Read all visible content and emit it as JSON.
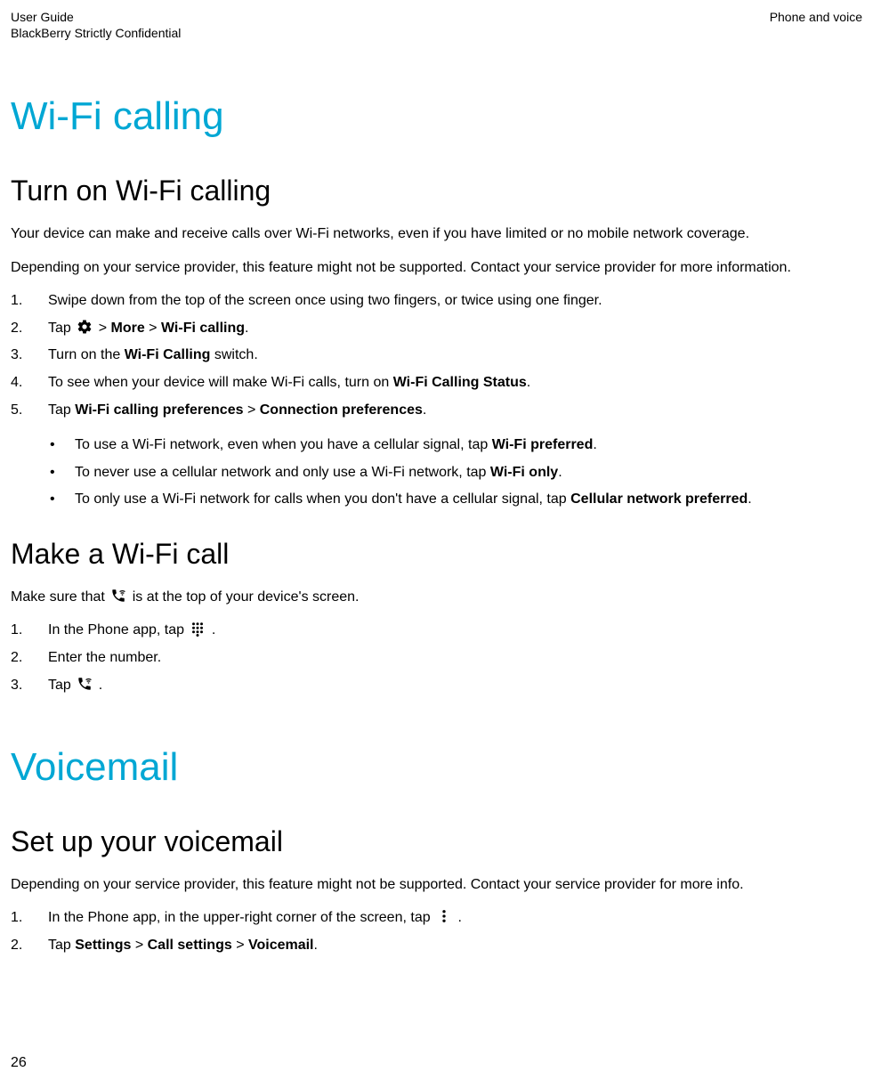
{
  "header": {
    "left_line1": "User Guide",
    "left_line2": "BlackBerry Strictly Confidential",
    "right": "Phone and voice"
  },
  "page_number": "26",
  "sections": {
    "wifi_calling": {
      "title": "Wi-Fi calling",
      "turn_on": {
        "heading": "Turn on Wi-Fi calling",
        "p1": "Your device can make and receive calls over Wi-Fi networks, even if you have limited or no mobile network coverage.",
        "p2": "Depending on your service provider, this feature might not be supported. Contact your service provider for more information.",
        "steps": {
          "s1": "Swipe down from the top of the screen once using two fingers, or twice using one finger.",
          "s2_pre": "Tap ",
          "s2_gt1": " > ",
          "s2_more": "More",
          "s2_gt2": " > ",
          "s2_wifi": "Wi-Fi calling",
          "s2_end": ".",
          "s3_pre": "Turn on the ",
          "s3_bold": "Wi-Fi Calling",
          "s3_post": " switch.",
          "s4_pre": "To see when your device will make Wi-Fi calls, turn on ",
          "s4_bold": "Wi-Fi Calling Status",
          "s4_post": ".",
          "s5_pre": "Tap ",
          "s5_b1": "Wi-Fi calling preferences",
          "s5_gt": " > ",
          "s5_b2": "Connection preferences",
          "s5_post": "."
        },
        "bullets": {
          "b1_pre": "To use a Wi-Fi network, even when you have a cellular signal, tap ",
          "b1_bold": "Wi-Fi preferred",
          "b1_post": ".",
          "b2_pre": "To never use a cellular network and only use a Wi-Fi network, tap ",
          "b2_bold": "Wi-Fi only",
          "b2_post": ".",
          "b3_pre": "To only use a Wi-Fi network for calls when you don't have a cellular signal, tap ",
          "b3_bold": "Cellular network preferred",
          "b3_post": "."
        }
      },
      "make_call": {
        "heading": "Make a Wi-Fi call",
        "p_pre": "Make sure that ",
        "p_post": " is at the top of your device's screen.",
        "steps": {
          "s1_pre": "In the Phone app, tap ",
          "s1_post": " .",
          "s2": "Enter the number.",
          "s3_pre": "Tap ",
          "s3_post": " ."
        }
      }
    },
    "voicemail": {
      "title": "Voicemail",
      "setup": {
        "heading": "Set up your voicemail",
        "p1": "Depending on your service provider, this feature might not be supported. Contact your service provider for more info.",
        "steps": {
          "s1_pre": "In the Phone app, in the upper-right corner of the screen, tap ",
          "s1_post": " .",
          "s2_pre": "Tap ",
          "s2_b1": "Settings",
          "s2_g1": " > ",
          "s2_b2": "Call settings",
          "s2_g2": " > ",
          "s2_b3": "Voicemail",
          "s2_post": "."
        }
      }
    }
  },
  "icons": {
    "settings_gear": "settings-gear-icon",
    "wifi_call": "wifi-call-icon",
    "dialpad": "dialpad-icon",
    "phone_wifi": "phone-wifi-icon",
    "more_vert": "more-vert-icon"
  }
}
